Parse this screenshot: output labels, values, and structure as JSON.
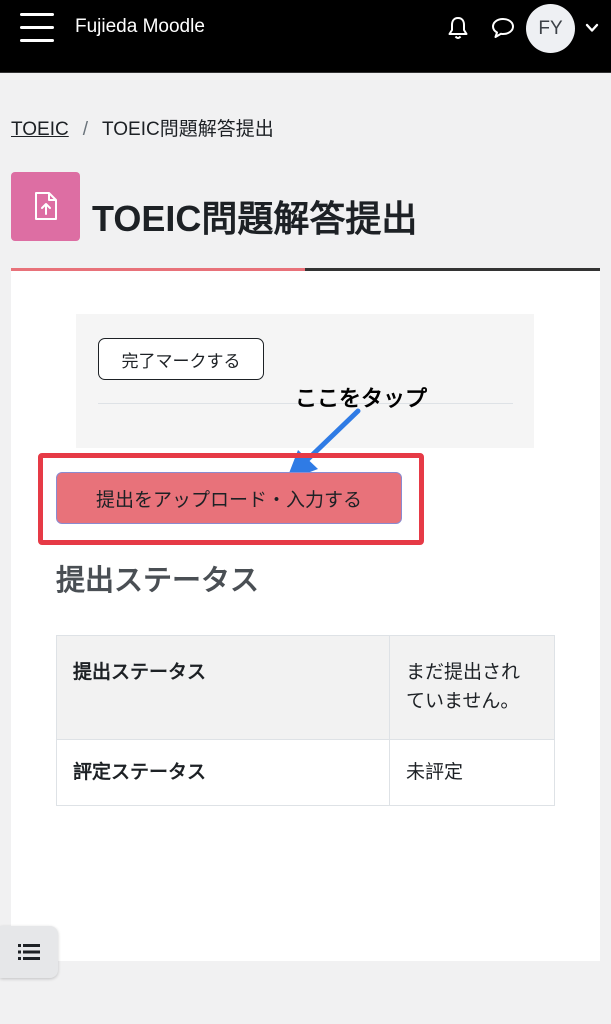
{
  "navbar": {
    "site_name": "Fujieda Moodle",
    "avatar_initials": "FY",
    "icons": [
      "menu-icon",
      "bell-icon",
      "chat-icon",
      "chevron-down-icon"
    ]
  },
  "breadcrumb": {
    "items": [
      "TOEIC",
      "TOEIC問題解答提出"
    ],
    "separator": "/"
  },
  "page": {
    "title": "TOEIC問題解答提出",
    "icon": "assignment-upload-icon",
    "icon_color": "#dd6ea3"
  },
  "completion": {
    "button_label": "完了マークする"
  },
  "annotation": {
    "text": "ここをタップ",
    "arrow_color": "#2f7be5",
    "frame_color": "#e63a46"
  },
  "submission": {
    "upload_button_label": "提出をアップロード・入力する",
    "button_color": "#e8727a",
    "section_heading": "提出ステータス",
    "status_table": [
      {
        "label": "提出ステータス",
        "value": "まだ提出されていません。"
      },
      {
        "label": "評定ステータス",
        "value": "未評定"
      }
    ]
  },
  "drawer": {
    "icon": "list-icon"
  }
}
